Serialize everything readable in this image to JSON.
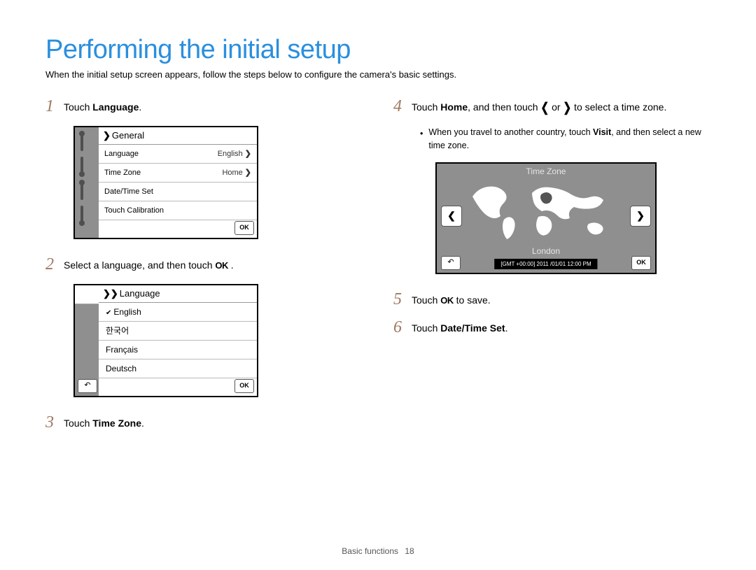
{
  "title": "Performing the initial setup",
  "intro": "When the initial setup screen appears, follow the steps below to configure the camera's basic settings.",
  "steps": {
    "s1": {
      "num": "1",
      "pre": "Touch ",
      "bold": "Language",
      "post": "."
    },
    "s2": {
      "num": "2",
      "pre": "Select a language, and then touch ",
      "ok": "OK",
      "post": " ."
    },
    "s3": {
      "num": "3",
      "pre": "Touch ",
      "bold": "Time Zone",
      "post": "."
    },
    "s4": {
      "num": "4",
      "pre": "Touch ",
      "bold": "Home",
      "mid": ", and then touch ",
      "arrowL": "❮",
      "or": " or ",
      "arrowR": "❯",
      "post": " to select a time zone."
    },
    "s5": {
      "num": "5",
      "pre": "Touch ",
      "ok": "OK",
      "post": " to save."
    },
    "s6": {
      "num": "6",
      "pre": "Touch ",
      "bold": "Date/Time Set",
      "post": "."
    }
  },
  "bullet4": {
    "pre": "When you travel to another country, touch ",
    "bold": "Visit",
    "post": ", and then select a new time zone."
  },
  "screen1": {
    "header_chev": "❯",
    "header": "General",
    "rows": [
      {
        "label": "Language",
        "value": "English",
        "chev": "❯"
      },
      {
        "label": "Time Zone",
        "value": "Home",
        "chev": "❯"
      },
      {
        "label": "Date/Time Set",
        "value": "",
        "chev": ""
      },
      {
        "label": "Touch Calibration",
        "value": "",
        "chev": ""
      }
    ],
    "ok": "OK"
  },
  "screen2": {
    "header_chev": "❯❯",
    "header": "Language",
    "items": [
      {
        "check": "✔",
        "label": "English"
      },
      {
        "check": "",
        "label": "한국어"
      },
      {
        "check": "",
        "label": "Français"
      },
      {
        "check": "",
        "label": "Deutsch"
      }
    ],
    "back": "↶",
    "ok": "OK"
  },
  "screen3": {
    "title": "Time Zone",
    "arrowL": "❮",
    "arrowR": "❯",
    "city": "London",
    "gmt": "[GMT +00:00]  2011 /01/01  12:00 PM",
    "back": "↶",
    "ok": "OK"
  },
  "footer": {
    "section": "Basic functions",
    "page": "18"
  }
}
